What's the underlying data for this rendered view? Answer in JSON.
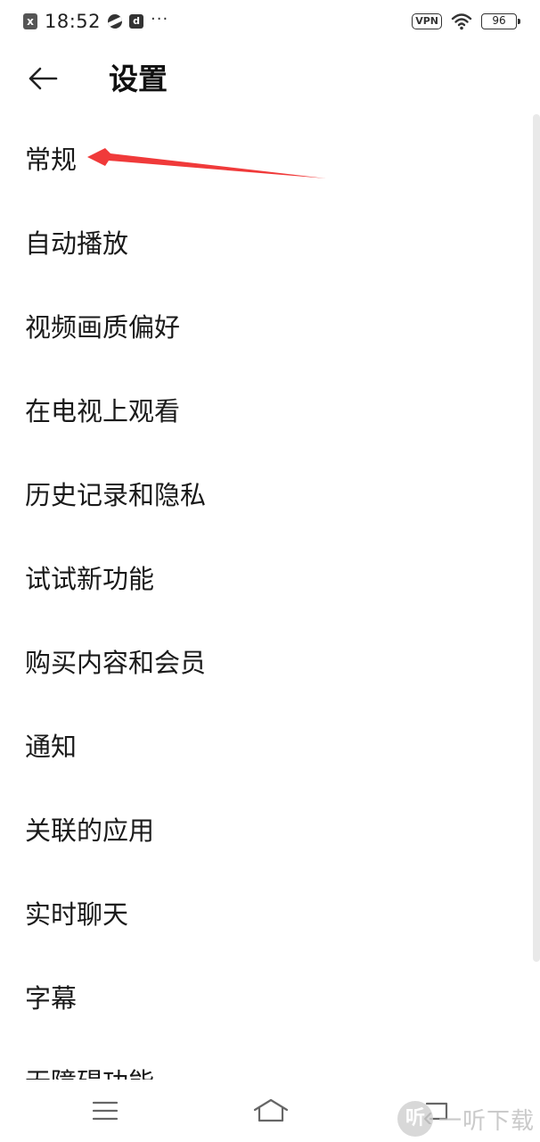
{
  "status_bar": {
    "time": "18:52",
    "notification_icon": "x-notification-icon",
    "more": "···",
    "vpn_label": "VPN",
    "battery_level": "96"
  },
  "header": {
    "title": "设置",
    "back_icon": "arrow-left-icon"
  },
  "settings": {
    "items": [
      {
        "label": "常规"
      },
      {
        "label": "自动播放"
      },
      {
        "label": "视频画质偏好"
      },
      {
        "label": "在电视上观看"
      },
      {
        "label": "历史记录和隐私"
      },
      {
        "label": "试试新功能"
      },
      {
        "label": "购买内容和会员"
      },
      {
        "label": "通知"
      },
      {
        "label": "关联的应用"
      },
      {
        "label": "实时聊天"
      },
      {
        "label": "字幕"
      },
      {
        "label": "无障碍功能"
      }
    ]
  },
  "annotation": {
    "color": "#f03a3a"
  },
  "nav_bar": {
    "menu_icon": "menu-icon",
    "home_icon": "home-icon",
    "back_icon": "back-icon"
  },
  "watermark": {
    "logo_char": "听",
    "text": "一听下载"
  }
}
